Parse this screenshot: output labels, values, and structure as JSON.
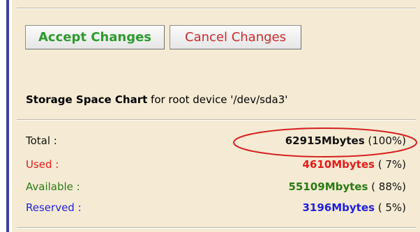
{
  "buttons": {
    "accept_label": "Accept Changes",
    "cancel_label": "Cancel Changes"
  },
  "chart": {
    "title_bold": "Storage Space Chart",
    "title_rest": " for root device '/dev/sda3'"
  },
  "rows": [
    {
      "label": "Total :",
      "amount": "62915",
      "unit": "Mbytes",
      "percent": " (100%)"
    },
    {
      "label": "Used :",
      "amount": "4610",
      "unit": "Mbytes",
      "percent": " ( 7%)"
    },
    {
      "label": "Available :",
      "amount": "55109",
      "unit": "Mbytes",
      "percent": " ( 88%)"
    },
    {
      "label": "Reserved :",
      "amount": "3196",
      "unit": "Mbytes",
      "percent": " ( 5%)"
    }
  ],
  "colors": {
    "panel": "#f5ebd4",
    "left_rule": "#3b3fa0",
    "accept_text": "#2e9a2e",
    "cancel_text": "#cc2a2a",
    "used": "#e31b1b",
    "available": "#2a7a13",
    "reserved": "#1f1fe0",
    "highlight_ellipse": "#d62020"
  }
}
